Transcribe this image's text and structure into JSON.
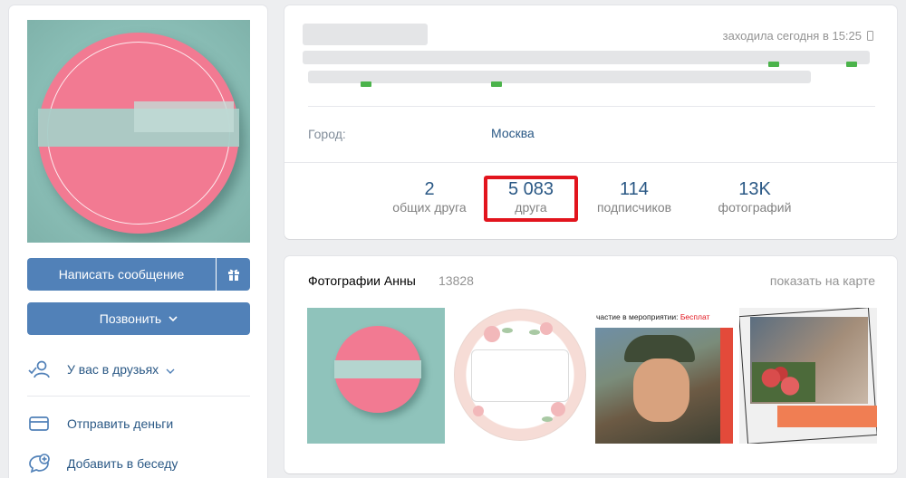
{
  "sidebar": {
    "message_button": "Написать сообщение",
    "call_button": "Позвонить",
    "friends_status": "У вас в друзьях",
    "send_money": "Отправить деньги",
    "add_to_chat": "Добавить в беседу"
  },
  "profile": {
    "last_seen": "заходила сегодня в 15:25",
    "city_label": "Город:",
    "city_value": "Москва"
  },
  "counters": [
    {
      "value": "2",
      "label": "общих друга"
    },
    {
      "value": "5 083",
      "label": "друга"
    },
    {
      "value": "114",
      "label": "подписчиков"
    },
    {
      "value": "13K",
      "label": "фотографий"
    }
  ],
  "photos": {
    "title": "Фотографии Анны",
    "count": "13828",
    "show_on_map": "показать на карте",
    "thumb3_caption_prefix": "частие в мероприятии: ",
    "thumb3_caption_accent": "Бесплат"
  },
  "colors": {
    "accent": "#5181b8",
    "link": "#2a5885",
    "highlight": "#e2141d",
    "muted": "#828282"
  }
}
